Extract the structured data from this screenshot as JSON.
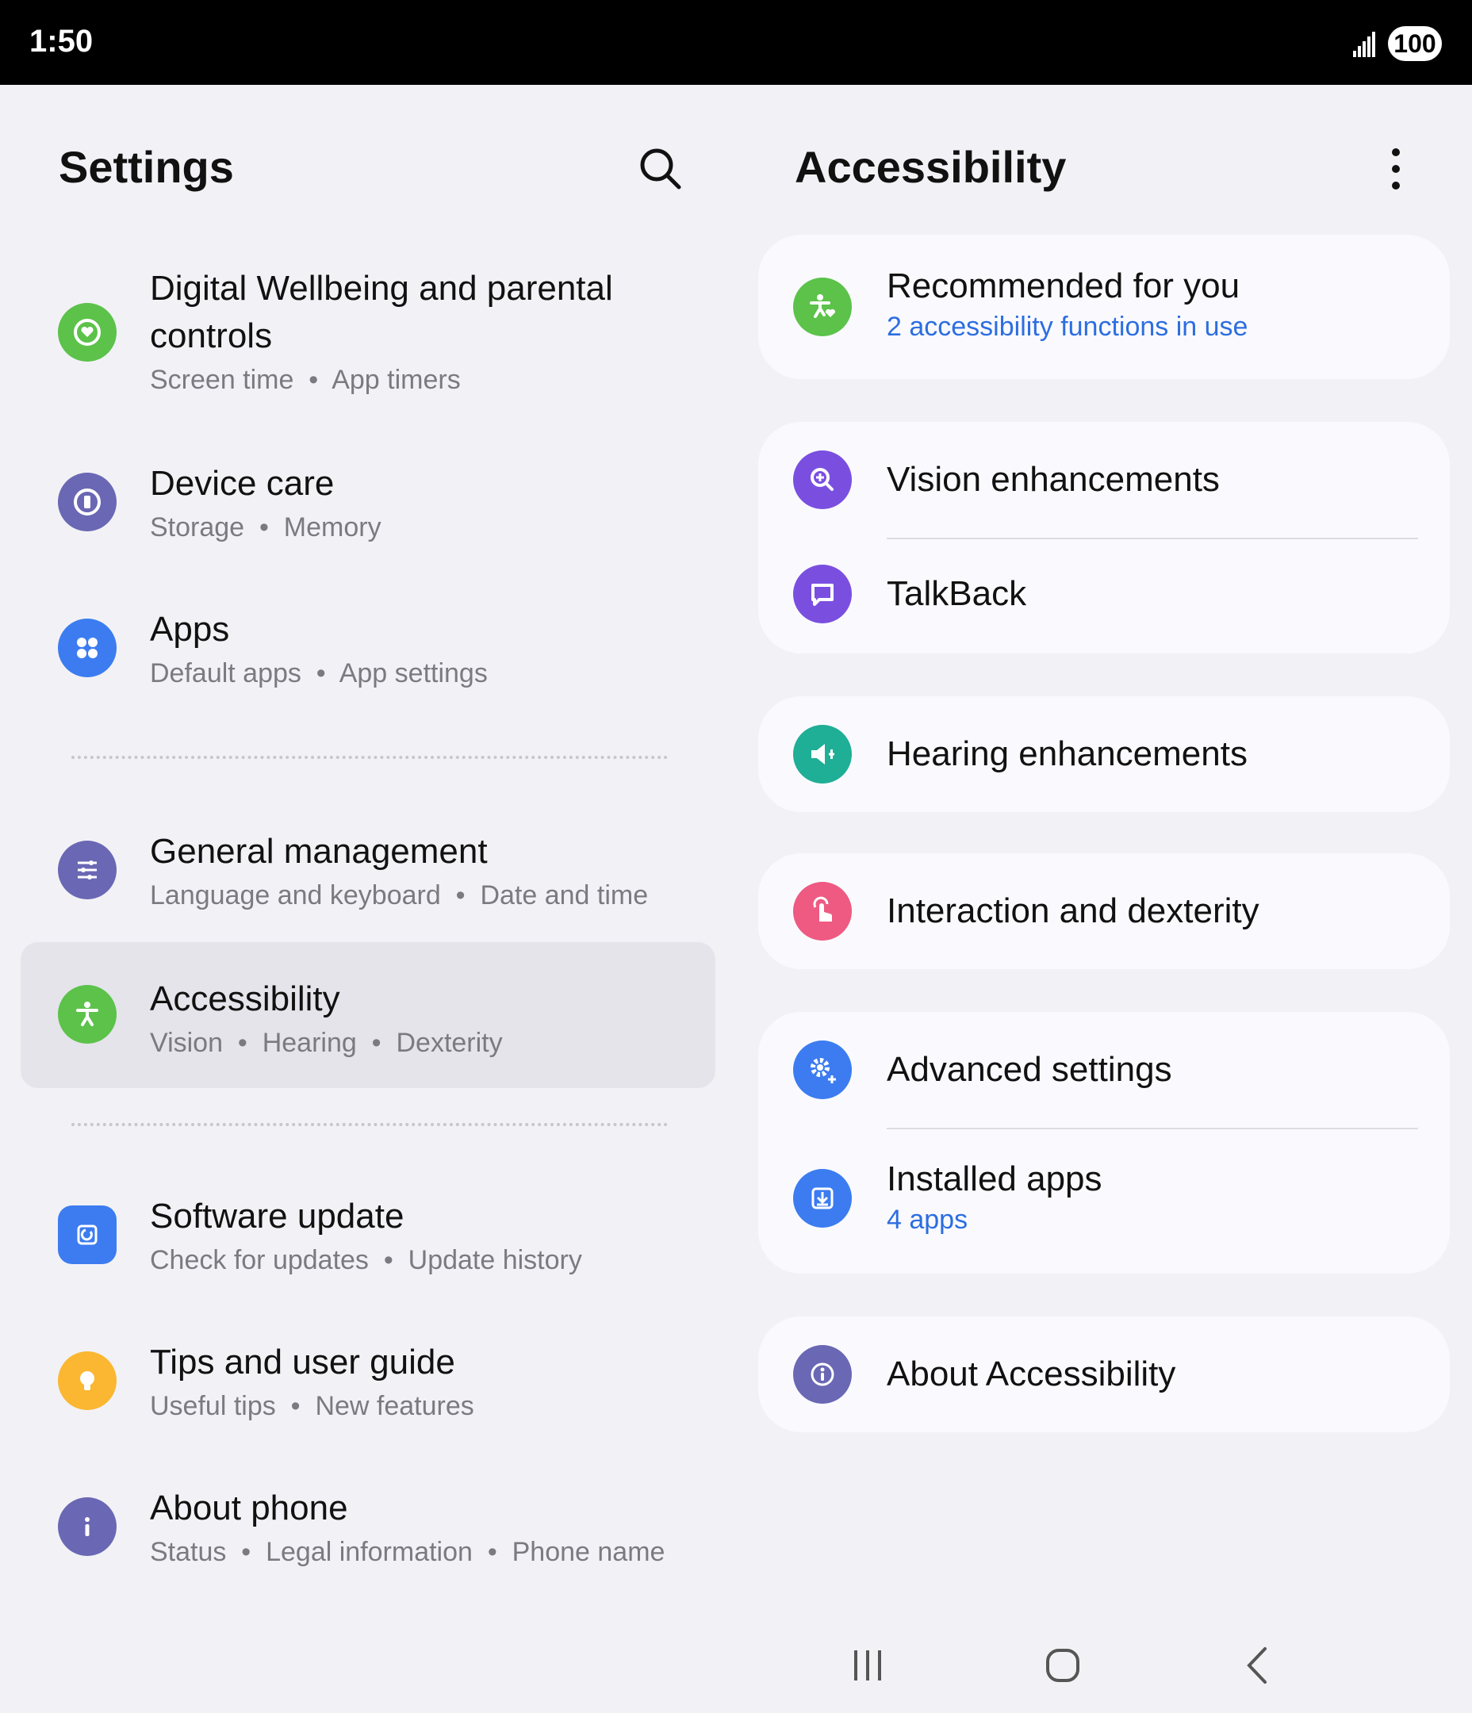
{
  "status_bar": {
    "time": "1:50",
    "battery": "100"
  },
  "left": {
    "title": "Settings",
    "items": [
      {
        "title": "Digital Wellbeing and parental controls",
        "subtitle": [
          "Screen time",
          "App timers"
        ]
      },
      {
        "title": "Device care",
        "subtitle": [
          "Storage",
          "Memory"
        ]
      },
      {
        "title": "Apps",
        "subtitle": [
          "Default apps",
          "App settings"
        ]
      },
      {
        "title": "General management",
        "subtitle": [
          "Language and keyboard",
          "Date and time"
        ]
      },
      {
        "title": "Accessibility",
        "subtitle": [
          "Vision",
          "Hearing",
          "Dexterity"
        ]
      },
      {
        "title": "Software update",
        "subtitle": [
          "Check for updates",
          "Update history"
        ]
      },
      {
        "title": "Tips and user guide",
        "subtitle": [
          "Useful tips",
          "New features"
        ]
      },
      {
        "title": "About phone",
        "subtitle": [
          "Status",
          "Legal information",
          "Phone name"
        ]
      }
    ]
  },
  "right": {
    "title": "Accessibility",
    "items": {
      "recommended": {
        "title": "Recommended for you",
        "subtitle": "2 accessibility functions in use"
      },
      "vision": {
        "title": "Vision enhancements"
      },
      "talkback": {
        "title": "TalkBack"
      },
      "hearing": {
        "title": "Hearing enhancements"
      },
      "interaction": {
        "title": "Interaction and dexterity"
      },
      "advanced": {
        "title": "Advanced settings"
      },
      "installed": {
        "title": "Installed apps",
        "subtitle": "4 apps"
      },
      "about": {
        "title": "About Accessibility"
      }
    }
  },
  "icons": {
    "wellbeing": "wellbeing-icon",
    "device_care": "device-care-icon",
    "apps": "apps-icon",
    "general": "sliders-icon",
    "accessibility": "accessibility-icon",
    "software": "software-update-icon",
    "tips": "lightbulb-icon",
    "about_phone": "info-icon"
  },
  "colors": {
    "green": "#5cc24a",
    "purple": "#6a68b4",
    "blue": "#3c7cf0",
    "teal": "#1fae96",
    "pink": "#ee5a82",
    "violet": "#7a4fe0",
    "yellow": "#fbb731",
    "link": "#2d6ee0"
  }
}
